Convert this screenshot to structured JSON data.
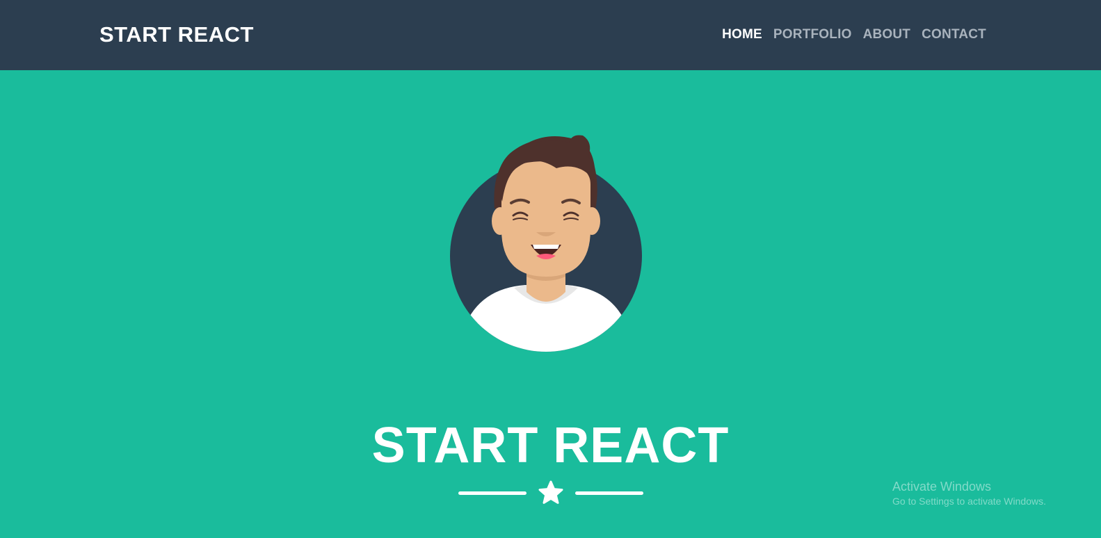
{
  "navbar": {
    "brand": "START REACT",
    "items": [
      {
        "label": "HOME",
        "active": true
      },
      {
        "label": "PORTFOLIO",
        "active": false
      },
      {
        "label": "ABOUT",
        "active": false
      },
      {
        "label": "CONTACT",
        "active": false
      }
    ]
  },
  "masthead": {
    "avatar_icon": "smiling-person-avatar-icon",
    "heading": "START REACT",
    "divider_icon": "star-icon"
  },
  "watermark": {
    "title": "Activate Windows",
    "subtitle": "Go to Settings to activate Windows."
  },
  "colors": {
    "navbar_bg": "#2c3e50",
    "masthead_bg": "#1abc9c",
    "text_primary": "#ffffff",
    "nav_inactive": "#a9b3bd"
  }
}
